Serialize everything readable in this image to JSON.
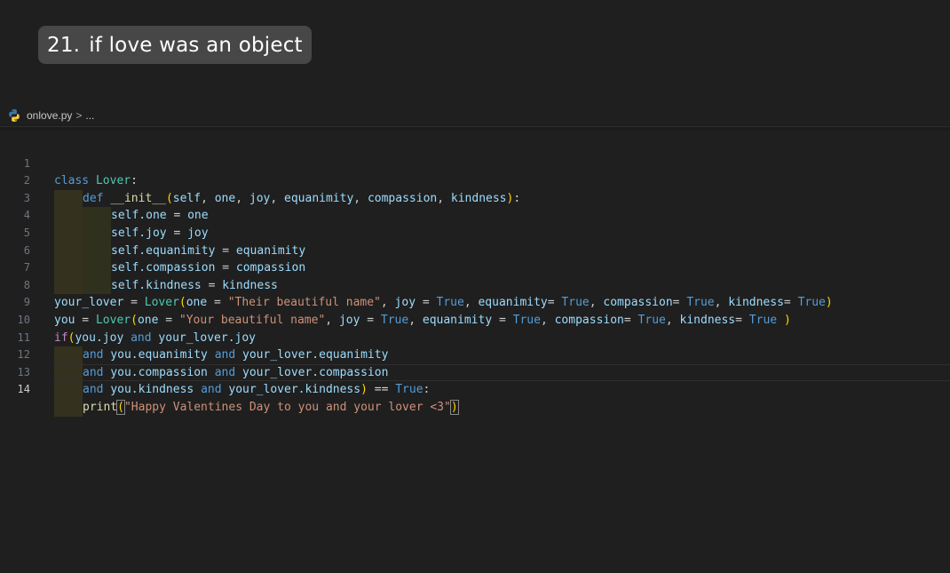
{
  "title_chip": {
    "number": "21.",
    "text": "if love was an object"
  },
  "breadcrumb": {
    "file": "onlove.py",
    "separator": ">",
    "rest": "..."
  },
  "editor": {
    "current_line": 14,
    "lines": [
      {
        "n": "1"
      },
      {
        "n": "2"
      },
      {
        "n": "3"
      },
      {
        "n": "4"
      },
      {
        "n": "5"
      },
      {
        "n": "6"
      },
      {
        "n": "7"
      },
      {
        "n": "8"
      },
      {
        "n": "9"
      },
      {
        "n": "10"
      },
      {
        "n": "11"
      },
      {
        "n": "12"
      },
      {
        "n": "13"
      },
      {
        "n": "14"
      }
    ],
    "tokens": {
      "l1": [
        "class",
        "Lover",
        ":"
      ],
      "l2": [
        "def",
        "__init__",
        "(",
        "self",
        "one",
        "joy",
        "equanimity",
        "compassion",
        "kindness",
        ")",
        ":"
      ],
      "l3": [
        "self.one",
        "one"
      ],
      "l4": [
        "self.joy",
        "joy"
      ],
      "l5": [
        "self.equanimity",
        "equanimity"
      ],
      "l6": [
        "self.compassion",
        "compassion"
      ],
      "l7": [
        "self.kindness",
        "kindness"
      ],
      "l8": [
        "your_lover",
        "Lover",
        "one",
        "\"Their beautiful name\"",
        "joy",
        "True",
        "equanimity",
        "True",
        "compassion",
        "True",
        "kindness",
        "True"
      ],
      "l9": [
        "you",
        "Lover",
        "one",
        "\"Your beautiful name\"",
        "joy",
        "True",
        "equanimity",
        "True",
        "compassion",
        "True",
        "kindness",
        "True"
      ],
      "l10": [
        "if",
        "you.joy",
        "and",
        "your_lover.joy"
      ],
      "l11": [
        "and",
        "you.equanimity",
        "and",
        "your_lover.equanimity"
      ],
      "l12": [
        "and",
        "you.compassion",
        "and",
        "your_lover.compassion"
      ],
      "l13": [
        "and",
        "you.kindness",
        "and",
        "your_lover.kindness",
        "==",
        "True"
      ],
      "l14": [
        "print",
        "\"Happy Valentines Day to you and your lover <3\""
      ]
    }
  },
  "colors": {
    "background": "#1f1f1f",
    "keyword": "#569cd6",
    "control": "#c586c0",
    "class_name": "#4ec9b0",
    "function": "#dcdcaa",
    "variable": "#9cdcfe",
    "string": "#ce9178"
  },
  "icons": {
    "file_icon": "python-icon"
  }
}
